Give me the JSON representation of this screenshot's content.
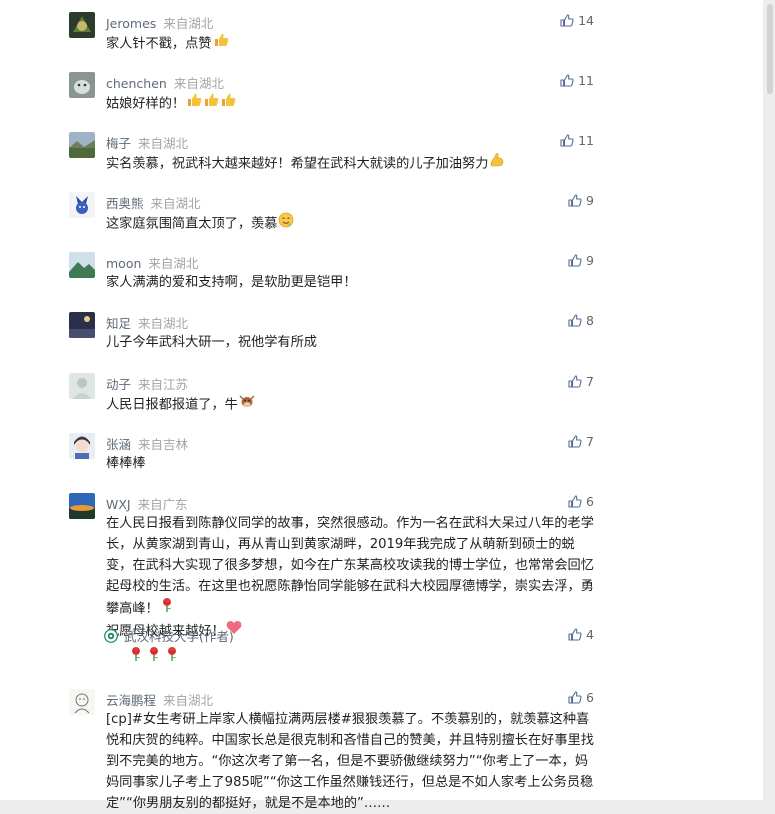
{
  "comments": [
    {
      "name": "Jeromes",
      "location": "来自湖北",
      "likes": "14",
      "text": "家人针不戳，点赞",
      "emoji": [
        "thumbs-up"
      ],
      "avatar": "dark-emblem"
    },
    {
      "name": "chenchen",
      "location": "来自湖北",
      "likes": "11",
      "text": "姑娘好样的！",
      "emoji": [
        "thumbs-up",
        "thumbs-up",
        "thumbs-up"
      ],
      "avatar": "grey-dog"
    },
    {
      "name": "梅子",
      "location": "来自湖北",
      "likes": "11",
      "text": "实名羡慕，祝武科大越来越好！希望在武科大就读的儿子加油努力",
      "emoji": [
        "flexed-biceps"
      ],
      "avatar": "landscape"
    },
    {
      "name": "西奥熊",
      "location": "来自湖北",
      "likes": "9",
      "text": "这家庭氛围简直太顶了，羡慕",
      "emoji": [
        "drooling-face"
      ],
      "avatar": "blue-character"
    },
    {
      "name": "moon",
      "location": "来自湖北",
      "likes": "9",
      "text": "家人满满的爱和支持啊，是软肋更是铠甲！",
      "emoji": [],
      "avatar": "mountain"
    },
    {
      "name": "知足",
      "location": "来自湖北",
      "likes": "8",
      "text": "儿子今年武科大研一，祝他学有所成",
      "emoji": [],
      "avatar": "night-scene"
    },
    {
      "name": "动子",
      "location": "来自江苏",
      "likes": "7",
      "text": "人民日报都报道了，牛",
      "emoji": [
        "cow-face"
      ],
      "avatar": "pale-figure"
    },
    {
      "name": "张涵",
      "location": "来自吉林",
      "likes": "7",
      "text": "棒棒棒",
      "emoji": [],
      "avatar": "anime-boy"
    },
    {
      "name": "WXJ",
      "location": "来自广东",
      "likes": "6",
      "text": "在人民日报看到陈静仪同学的故事，突然很感动。作为一名在武科大呆过八年的老学长，从黄家湖到青山，再从青山到黄家湖畔，2019年我完成了从萌新到硕士的蜕变，在武科大实现了很多梦想，如今在广东某高校攻读我的博士学位，也常常会回忆起母校的生活。在这里也祝愿陈静怡同学能够在武科大校园厚德博学，崇实去浮，勇攀高峰！",
      "text2": "祝愿母校越来越好！",
      "emoji": [
        "rose"
      ],
      "emoji2": [
        "heart"
      ],
      "avatar": "blue-sky",
      "reply": {
        "name": "武汉科技大学(作者)",
        "likes": "4",
        "emoji": [
          "rose",
          "rose",
          "rose"
        ]
      }
    },
    {
      "name": "云海鹏程",
      "location": "来自湖北",
      "likes": "6",
      "text": "[cp]#女生考研上岸家人横幅拉满两层楼#狠狠羡慕了。不羡慕别的，就羡慕这种喜悦和庆贺的纯粹。中国家长总是很克制和吝惜自己的赞美，并且特别擅长在好事里找到不完美的地方。“你这次考了第一名，但是不要骄傲继续努力”“你考上了一本，妈妈同事家儿子考上了985呢”“你这工作虽然赚钱还行，但总是不如人家考上公务员稳定”“你男朋友别的都挺好，就是不是本地的”……",
      "emoji": [],
      "avatar": "sketch"
    }
  ],
  "icons": {
    "like": "thumbs-up-outline-icon",
    "verified": "university-badge-icon"
  },
  "colors": {
    "name": "#5f6a78",
    "location": "#a4a4a4",
    "text": "#1f1f1f",
    "like": "#666666"
  }
}
